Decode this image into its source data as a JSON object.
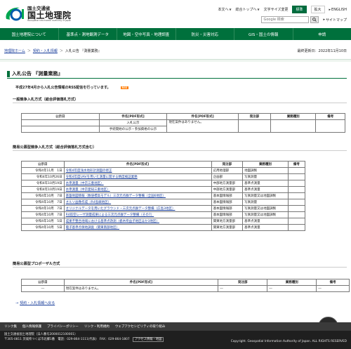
{
  "header": {
    "ministry": "国土交通省",
    "org_name": "国土地理院",
    "org_en": "Geospatial Information Authority of Japan",
    "util_links": [
      "本文へ",
      "総合トップへ",
      "文字サイズ変更"
    ],
    "size_buttons": [
      "標準",
      "拡大"
    ],
    "lang": "ENGLISH",
    "search_placeholder": "Google 検索",
    "sitemap": "サイトマップ"
  },
  "nav": [
    "国土地理院について",
    "基準点・測地観測データ",
    "地図・空中写真・地理調査",
    "防災・災害対応",
    "GIS・国土の情報",
    "申請"
  ],
  "breadcrumb": {
    "items": [
      "地理院ホーム",
      "契約・入札情報",
      "入札公告 『測量業務』"
    ],
    "updated": "最終更新日：2022年11月10日"
  },
  "page": {
    "title": "入札公告 『測量業務』",
    "intro": "平成27年4月から入札公告情報のRSS配信を行っています。",
    "rss_label": "RSS"
  },
  "section1": {
    "title": "一般競争入札方式（総合評価落札方式）",
    "headers": [
      "公示日",
      "件名[PDF形式]",
      "件名[PDF形式]",
      "発注部",
      "業務種別",
      "備考"
    ],
    "rows": [
      [
        "",
        "入札公示",
        "現在案件はありません。",
        "",
        "",
        ""
      ],
      [
        "",
        "手続開始の公示・参加資格の公示",
        "",
        "",
        "",
        ""
      ]
    ]
  },
  "section2": {
    "title": "簡易公募型競争入札方式（総合評価落札方式含む）",
    "headers": [
      "公示日",
      "件名[PDF形式]",
      "発注部",
      "業務種別",
      "備考"
    ],
    "rows": [
      [
        "令和4年11月　1日",
        "令和4年度浅水地形計測図の修正",
        "応用地理部",
        "地図調製",
        ""
      ],
      [
        "令和4年10月26日",
        "令和4年度UAVを用いた測量に関する精度検証業務",
        "企画部",
        "写真測量",
        ""
      ],
      [
        "令和4年10月19日",
        "水準測量（中京三重地区）",
        "中部地方測量部",
        "基準点測量",
        ""
      ],
      [
        "令和4年10月19日",
        "水準測量（中京愛知三重地区）",
        "中部地方測量部",
        "基準点測量",
        ""
      ],
      [
        "令和4年10月　7日",
        "基盤地図情報（数値標高モデル）三次元点群データ整備（全国6地区）",
        "基本図情報部",
        "写真測量又は地図調製",
        ""
      ],
      [
        "令和4年10月　7日",
        "オルソ画像作成（R4島嶼地区）",
        "基本図情報部",
        "写真測量",
        ""
      ],
      [
        "令和4年10月　7日",
        "オリジナルデータを用いたグラウンド・三次元点群データ整備（広島3地区）",
        "基本図情報部",
        "写真測量又は地図調製",
        ""
      ],
      [
        "令和4年10月　7日",
        "R4航空レーザ測量成果による三次元点群データ整備（その7）",
        "基本図情報部",
        "写真測量又は地図調製",
        ""
      ],
      [
        "令和4年10月　5日",
        "成果不整合地域における基準点改測（栃木県益子地区ほか3地区）",
        "関東地方測量部",
        "基準点測量",
        ""
      ],
      [
        "令和4年10月　5日",
        "電子基準点保地調査（関東南部地区）",
        "関東地方測量部",
        "基準点測量",
        ""
      ]
    ]
  },
  "section3": {
    "title": "簡易公募型プロポーザル方式",
    "headers": [
      "公示日",
      "件名[PDF形式]",
      "発注部",
      "業務種別",
      "備考"
    ],
    "rows": [
      [
        "―",
        "現在案件はありません。",
        "―",
        "―",
        "―"
      ]
    ]
  },
  "back_link": "契約・入札情報へ戻る",
  "footer": {
    "links": [
      "リンク集",
      "個人情報保護",
      "プライバシーポリシー",
      "リンク・利用規約",
      "ウェブアクセシビリティの取り組み"
    ],
    "address_line1": "国土交通省国土地理院（法人番号2000012100001）",
    "address_line2": "〒305-0811 茨城県つくば市北郷1番　電話：029-864-1111(代表)　FAX：029-864-1807",
    "access_button": "アクセス情報・地図",
    "copyright": "Copyright. Geospatial Information Authority of Japan. ALL RIGHTS RESERVED"
  },
  "colors": {
    "brand_green": "#00703c",
    "rss_orange": "#ff7b00"
  }
}
